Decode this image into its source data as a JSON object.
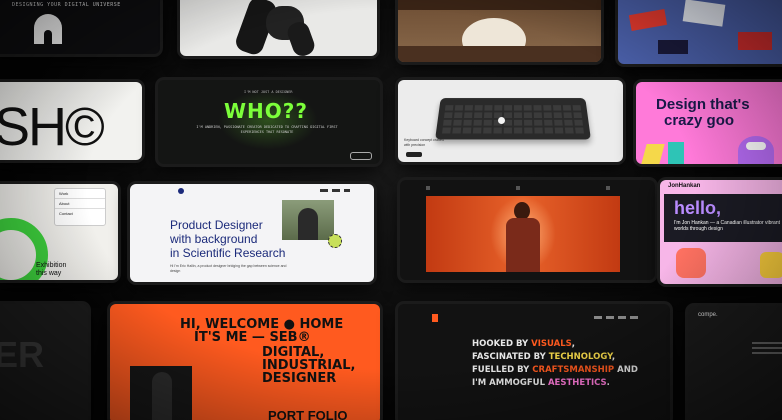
{
  "row1": {
    "t1_text": "DESIGNING YOUR DIGITAL UNIVERSE",
    "t2_text": "",
    "t3_text": "",
    "t4_text": ""
  },
  "row2": {
    "sh_text": "SH©",
    "who_text": "WHO??",
    "who_sub": "I'M NOT JUST A DESIGNER",
    "who_body": "I'M ANDRIEN, PASSIONATE CREATOR DEDICATED TO CRAFTING DIGITAL FIRST EXPERIENCES THAT RESONATE",
    "kb_caption": "Keyboard concept crafted with precision",
    "design_text": "Design that's",
    "design_text2": "crazy goo"
  },
  "row3": {
    "menu_items": [
      "Work",
      "About",
      "Contact"
    ],
    "exhibition_text": "Exhibition this way",
    "product_title_lines": [
      "Product Designer",
      "with background",
      "in Scientific Research"
    ],
    "product_body": "Hi I'm Eric Hallin, a product designer bridging the gap between science and design",
    "hello_text": "hello,",
    "jon_text": "I'm Jon Hankan — a Canadian illustrator vibrant worlds through design",
    "jon_header": "JonHankan"
  },
  "row4": {
    "left_text": "ER",
    "seb_lines": [
      "HI, WELCOME ● HOME",
      "IT'S ME — SEB®",
      "DIGITAL,",
      "INDUSTRIAL,",
      "DESIGNER"
    ],
    "seb_bottom": "PORT FOLIO",
    "hooked_lines": [
      {
        "a": "HOOKED BY ",
        "b": "VISUALS",
        "c": ","
      },
      {
        "a": "FASCINATED BY ",
        "b": "TECHNOLOGY",
        "c": ","
      },
      {
        "a": "FUELLED BY ",
        "b": "CRAFTSMANSHIP",
        "c": " AND"
      },
      {
        "a": "I'M AMMOGFUL ",
        "b": "AESTHETICS",
        "c": "."
      }
    ],
    "compe_text": "compe."
  },
  "colors": {
    "orange": "#ff5a1f",
    "green": "#7cff3a",
    "pink": "#ff7ad9",
    "yellow": "#f5d84a"
  }
}
